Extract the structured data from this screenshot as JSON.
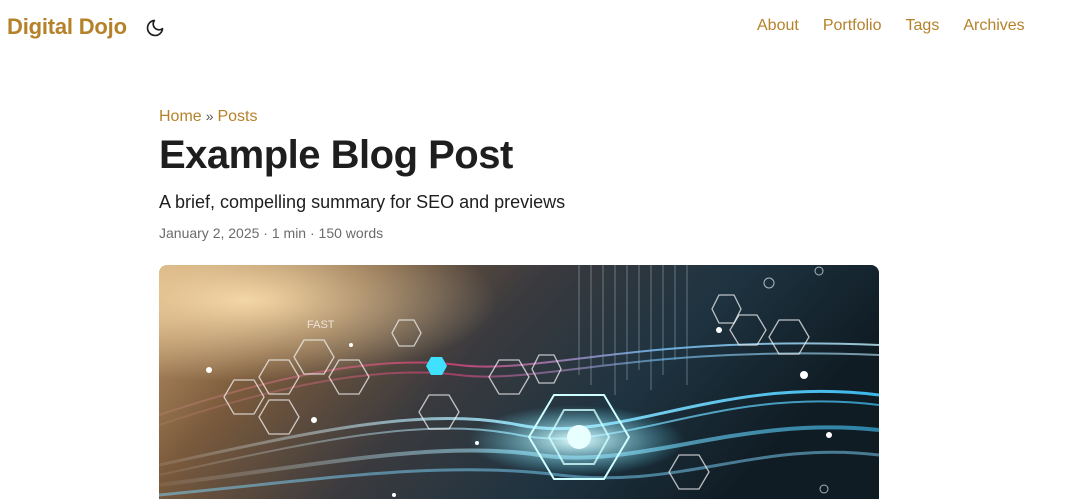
{
  "header": {
    "site_title": "Digital Dojo",
    "theme_toggle_icon": "moon-icon",
    "nav": [
      {
        "label": "About"
      },
      {
        "label": "Portfolio"
      },
      {
        "label": "Tags"
      },
      {
        "label": "Archives"
      }
    ]
  },
  "breadcrumb": {
    "items": [
      "Home",
      "Posts"
    ],
    "separator": "»"
  },
  "post": {
    "title": "Example Blog Post",
    "summary": "A brief, compelling summary for SEO and previews",
    "date": "January 2, 2025",
    "reading_time": "1 min",
    "word_count": "150 words",
    "meta_separator": "·",
    "cover_image": {
      "text_in_image": "FAST",
      "description_icon": "abstract-data-waves-image"
    }
  },
  "colors": {
    "accent": "#b5822a",
    "text": "#1e1e1e",
    "muted": "#6b6b6b"
  }
}
